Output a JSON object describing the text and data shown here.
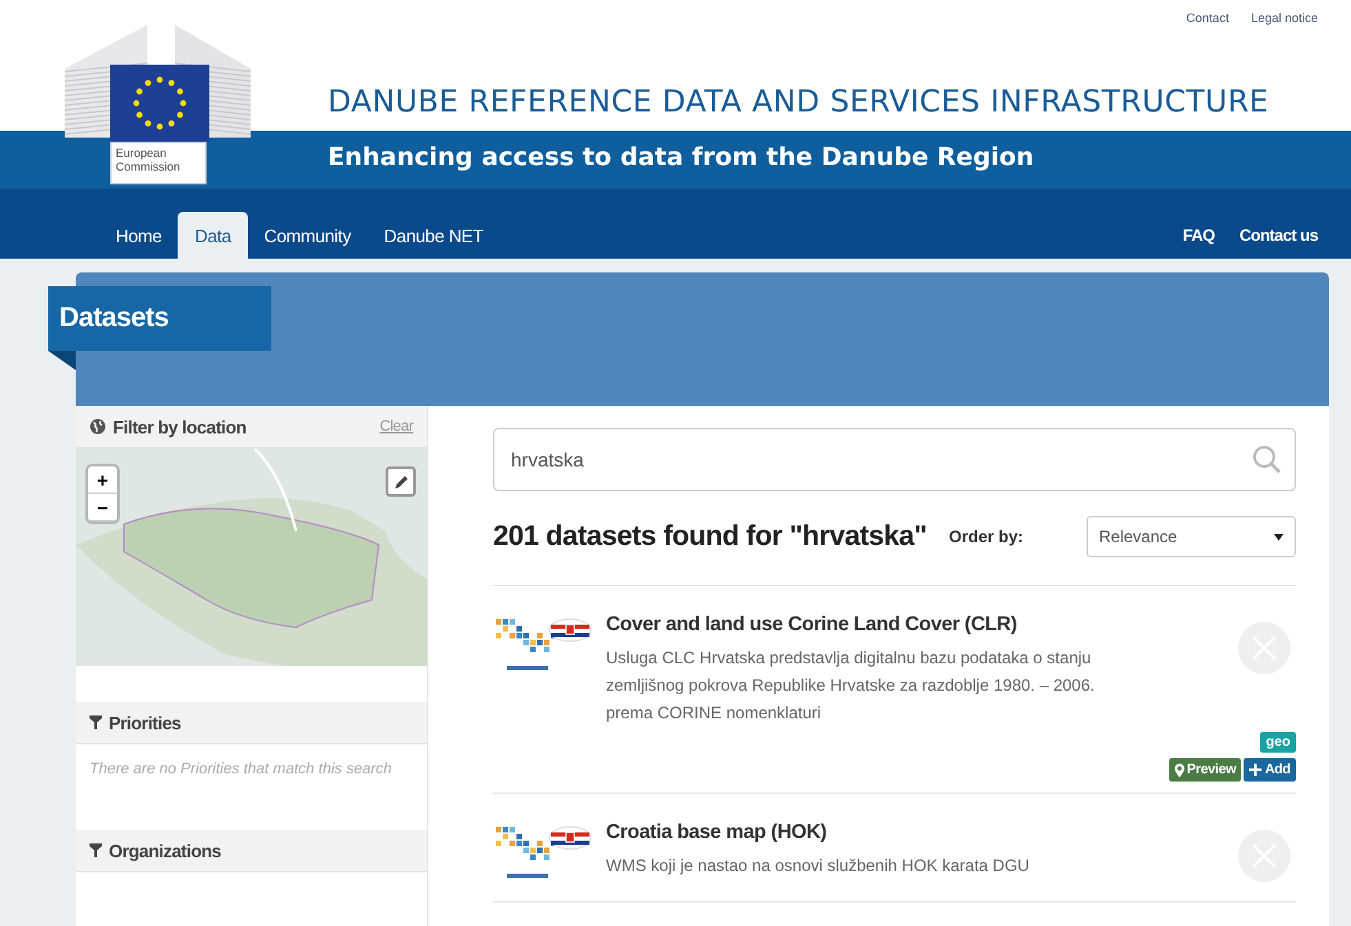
{
  "top_links": [
    "Contact",
    "Legal notice"
  ],
  "logo": {
    "caption": "European Commission"
  },
  "header": {
    "title": "DANUBE REFERENCE DATA AND SERVICES INFRASTRUCTURE",
    "subtitle": "Enhancing access to data from the Danube Region"
  },
  "nav": {
    "items": [
      {
        "label": "Home",
        "selected": false
      },
      {
        "label": "Data",
        "selected": true
      },
      {
        "label": "Community",
        "selected": false
      },
      {
        "label": "Danube NET",
        "selected": false
      }
    ],
    "right_items": [
      "FAQ",
      "Contact us"
    ]
  },
  "page_title": "Datasets",
  "sidebar": {
    "location": {
      "title": "Filter by location",
      "clear": "Clear",
      "zoom_in": "+",
      "zoom_out": "−"
    },
    "facets": [
      {
        "title": "Priorities",
        "empty_text": "There are no Priorities that match this search"
      },
      {
        "title": "Organizations"
      }
    ]
  },
  "search": {
    "value": "hrvatska",
    "results_text": "201 datasets found for \"hrvatska\"",
    "order_label": "Order by:",
    "order_value": "Relevance"
  },
  "datasets": [
    {
      "title": "Cover and land use Corine Land Cover (CLR)",
      "description": "Usluga CLC Hrvatska predstavlja digitalnu bazu podataka o stanju zemljišnog pokrova Republike Hrvatske za razdoblje 1980. – 2006. prema CORINE nomenklaturi",
      "tags": [
        "geo"
      ],
      "actions": [
        {
          "kind": "preview",
          "label": "Preview"
        },
        {
          "kind": "add",
          "label": "Add"
        }
      ]
    },
    {
      "title": "Croatia base map (HOK)",
      "description": "WMS koji je nastao na osnovi službenih HOK karata DGU"
    }
  ]
}
